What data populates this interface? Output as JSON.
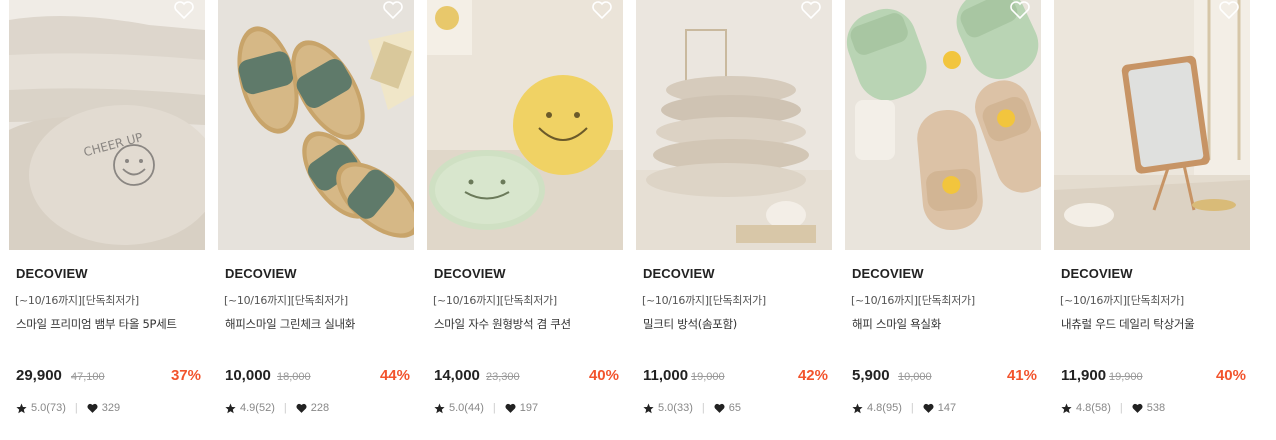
{
  "products": [
    {
      "brand": "DECOVIEW",
      "promo": "[~10/16까지][단독최저가]",
      "name": "스마일 프리미엄 뱀부 타올 5P세트",
      "price": "29,900",
      "original_price": "47,100",
      "discount": "37%",
      "rating": "5.0(73)",
      "likes": "329",
      "image": "towel-photo"
    },
    {
      "brand": "DECOVIEW",
      "promo": "[~10/16까지][단독최저가]",
      "name": "해피스마일 그린체크 실내화",
      "price": "10,000",
      "original_price": "18,000",
      "discount": "44%",
      "rating": "4.9(52)",
      "likes": "228",
      "image": "slipper-photo"
    },
    {
      "brand": "DECOVIEW",
      "promo": "[~10/16까지][단독최저가]",
      "name": "스마일 자수 원형방석 겸 쿠션",
      "price": "14,000",
      "original_price": "23,300",
      "discount": "40%",
      "rating": "5.0(44)",
      "likes": "197",
      "image": "cushion-photo"
    },
    {
      "brand": "DECOVIEW",
      "promo": "[~10/16까지][단독최저가]",
      "name": "밀크티 방석(솜포함)",
      "price": "11,000",
      "original_price": "19,000",
      "discount": "42%",
      "rating": "5.0(33)",
      "likes": "65",
      "image": "pillow-photo"
    },
    {
      "brand": "DECOVIEW",
      "promo": "[~10/16까지][단독최저가]",
      "name": "해피 스마일 욕실화",
      "price": "5,900",
      "original_price": "10,000",
      "discount": "41%",
      "rating": "4.8(95)",
      "likes": "147",
      "image": "bath-slipper-photo"
    },
    {
      "brand": "DECOVIEW",
      "promo": "[~10/16까지][단독최저가]",
      "name": "내츄럴 우드 데일리 탁상거울",
      "price": "11,900",
      "original_price": "19,900",
      "discount": "40%",
      "rating": "4.8(58)",
      "likes": "538",
      "image": "mirror-photo"
    }
  ],
  "colors": {
    "discount": "#f2542d",
    "text": "#222222",
    "muted": "#999999"
  }
}
